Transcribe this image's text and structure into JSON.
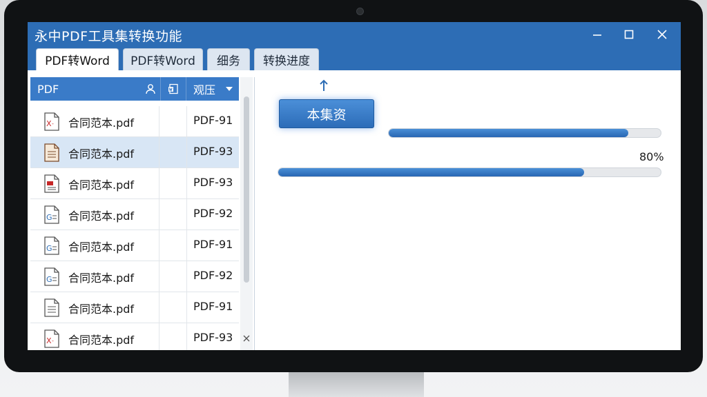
{
  "window": {
    "title": "永中PDF工具集转换功能",
    "minimize_icon": "minimize-icon",
    "maximize_icon": "maximize-icon",
    "close_icon": "close-icon"
  },
  "tabs": [
    {
      "label": "PDF转Word",
      "active": true
    },
    {
      "label": "PDF转Word",
      "active": false
    },
    {
      "label": "细务",
      "active": false
    },
    {
      "label": "转换进度",
      "active": false
    }
  ],
  "file_list": {
    "header": {
      "name_col": "PDF",
      "sort_col": "观压"
    },
    "rows": [
      {
        "name": "合同范本.pdf",
        "code": "PDF-91",
        "icon": "pdf-red-x-icon"
      },
      {
        "name": "合同范本.pdf",
        "code": "PDF-93",
        "icon": "document-icon",
        "selected": true
      },
      {
        "name": "合同范本.pdf",
        "code": "PDF-93",
        "icon": "pdf-red-icon"
      },
      {
        "name": "合同范本.pdf",
        "code": "PDF-92",
        "icon": "document-gear-icon"
      },
      {
        "name": "合同范本.pdf",
        "code": "PDF-91",
        "icon": "document-gear-icon"
      },
      {
        "name": "合同范本.pdf",
        "code": "PDF-92",
        "icon": "document-gear-icon"
      },
      {
        "name": "合同范本.pdf",
        "code": "PDF-91",
        "icon": "document-icon"
      },
      {
        "name": "合同范本.pdf",
        "code": "PDF-93",
        "icon": "pdf-red-x-icon"
      }
    ]
  },
  "conversion": {
    "button_label": "本集资",
    "progress_top": 0.88,
    "progress_main": 0.8,
    "progress_main_label": "80%"
  },
  "colors": {
    "title_bar": "#2d6db5",
    "header": "#3a7bc8",
    "accent": "#2866b3"
  }
}
